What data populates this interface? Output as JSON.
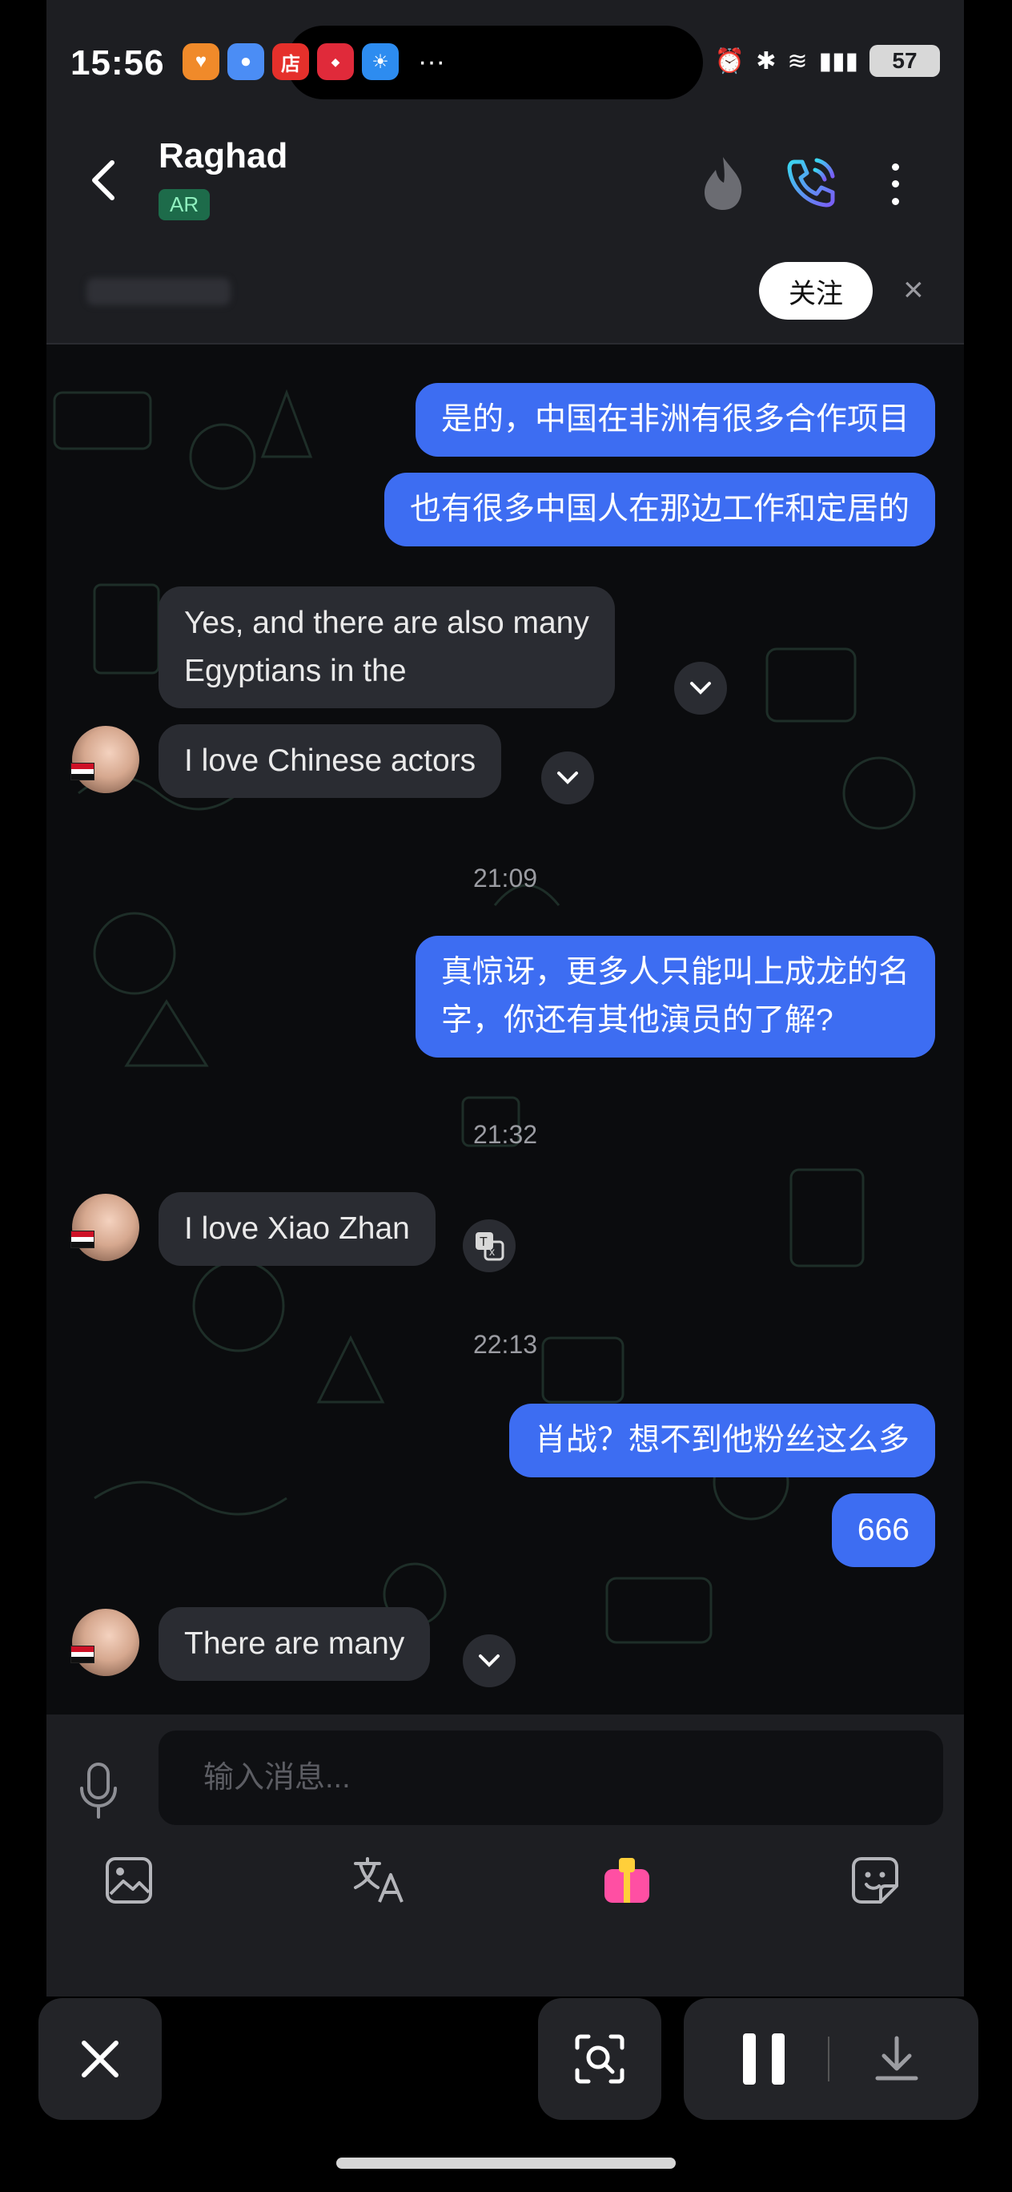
{
  "status_bar": {
    "time": "15:56",
    "app_icons": [
      {
        "name": "heart-app-icon",
        "label": "",
        "color": "#f08a2a"
      },
      {
        "name": "message-app-icon",
        "label": "",
        "color": "#4b8df5"
      },
      {
        "name": "store-app-icon",
        "label": "店",
        "color": "#e5302b"
      },
      {
        "name": "xiaohongshu-app-icon",
        "label": "",
        "color": "#e02a3a"
      },
      {
        "name": "weather-app-icon",
        "label": "",
        "color": "#2d8cf0"
      }
    ],
    "overflow": "···",
    "battery": "57"
  },
  "header": {
    "contact_name": "Raghad",
    "language_badge": "AR"
  },
  "follow_bar": {
    "follow_label": "关注",
    "close_label": "×"
  },
  "messages": [
    {
      "direction": "out",
      "text": "是的，中国在非洲有很多合作项目"
    },
    {
      "direction": "out",
      "text": "也有很多中国人在那边工作和定居的"
    },
    {
      "direction": "in",
      "text": "Yes, and there are also many\nEgyptians in the"
    },
    {
      "direction": "in",
      "text": "I love Chinese actors"
    },
    {
      "direction": "out",
      "text": "真惊讶，更多人只能叫上成龙的名\n字，你还有其他演员的了解?"
    },
    {
      "direction": "in",
      "text": "I love Xiao Zhan"
    },
    {
      "direction": "out",
      "text": "肖战？想不到他粉丝这么多"
    },
    {
      "direction": "out",
      "text": "666"
    },
    {
      "direction": "in",
      "text": "There are many"
    }
  ],
  "timestamps": [
    "21:09",
    "21:32",
    "22:13"
  ],
  "input": {
    "placeholder": "输入消息..."
  },
  "colors": {
    "outgoing_bubble": "#3d6df2",
    "incoming_bubble": "#2a2c32",
    "background": "#0b0c0e",
    "gift_icon": "#ff4fa3"
  }
}
